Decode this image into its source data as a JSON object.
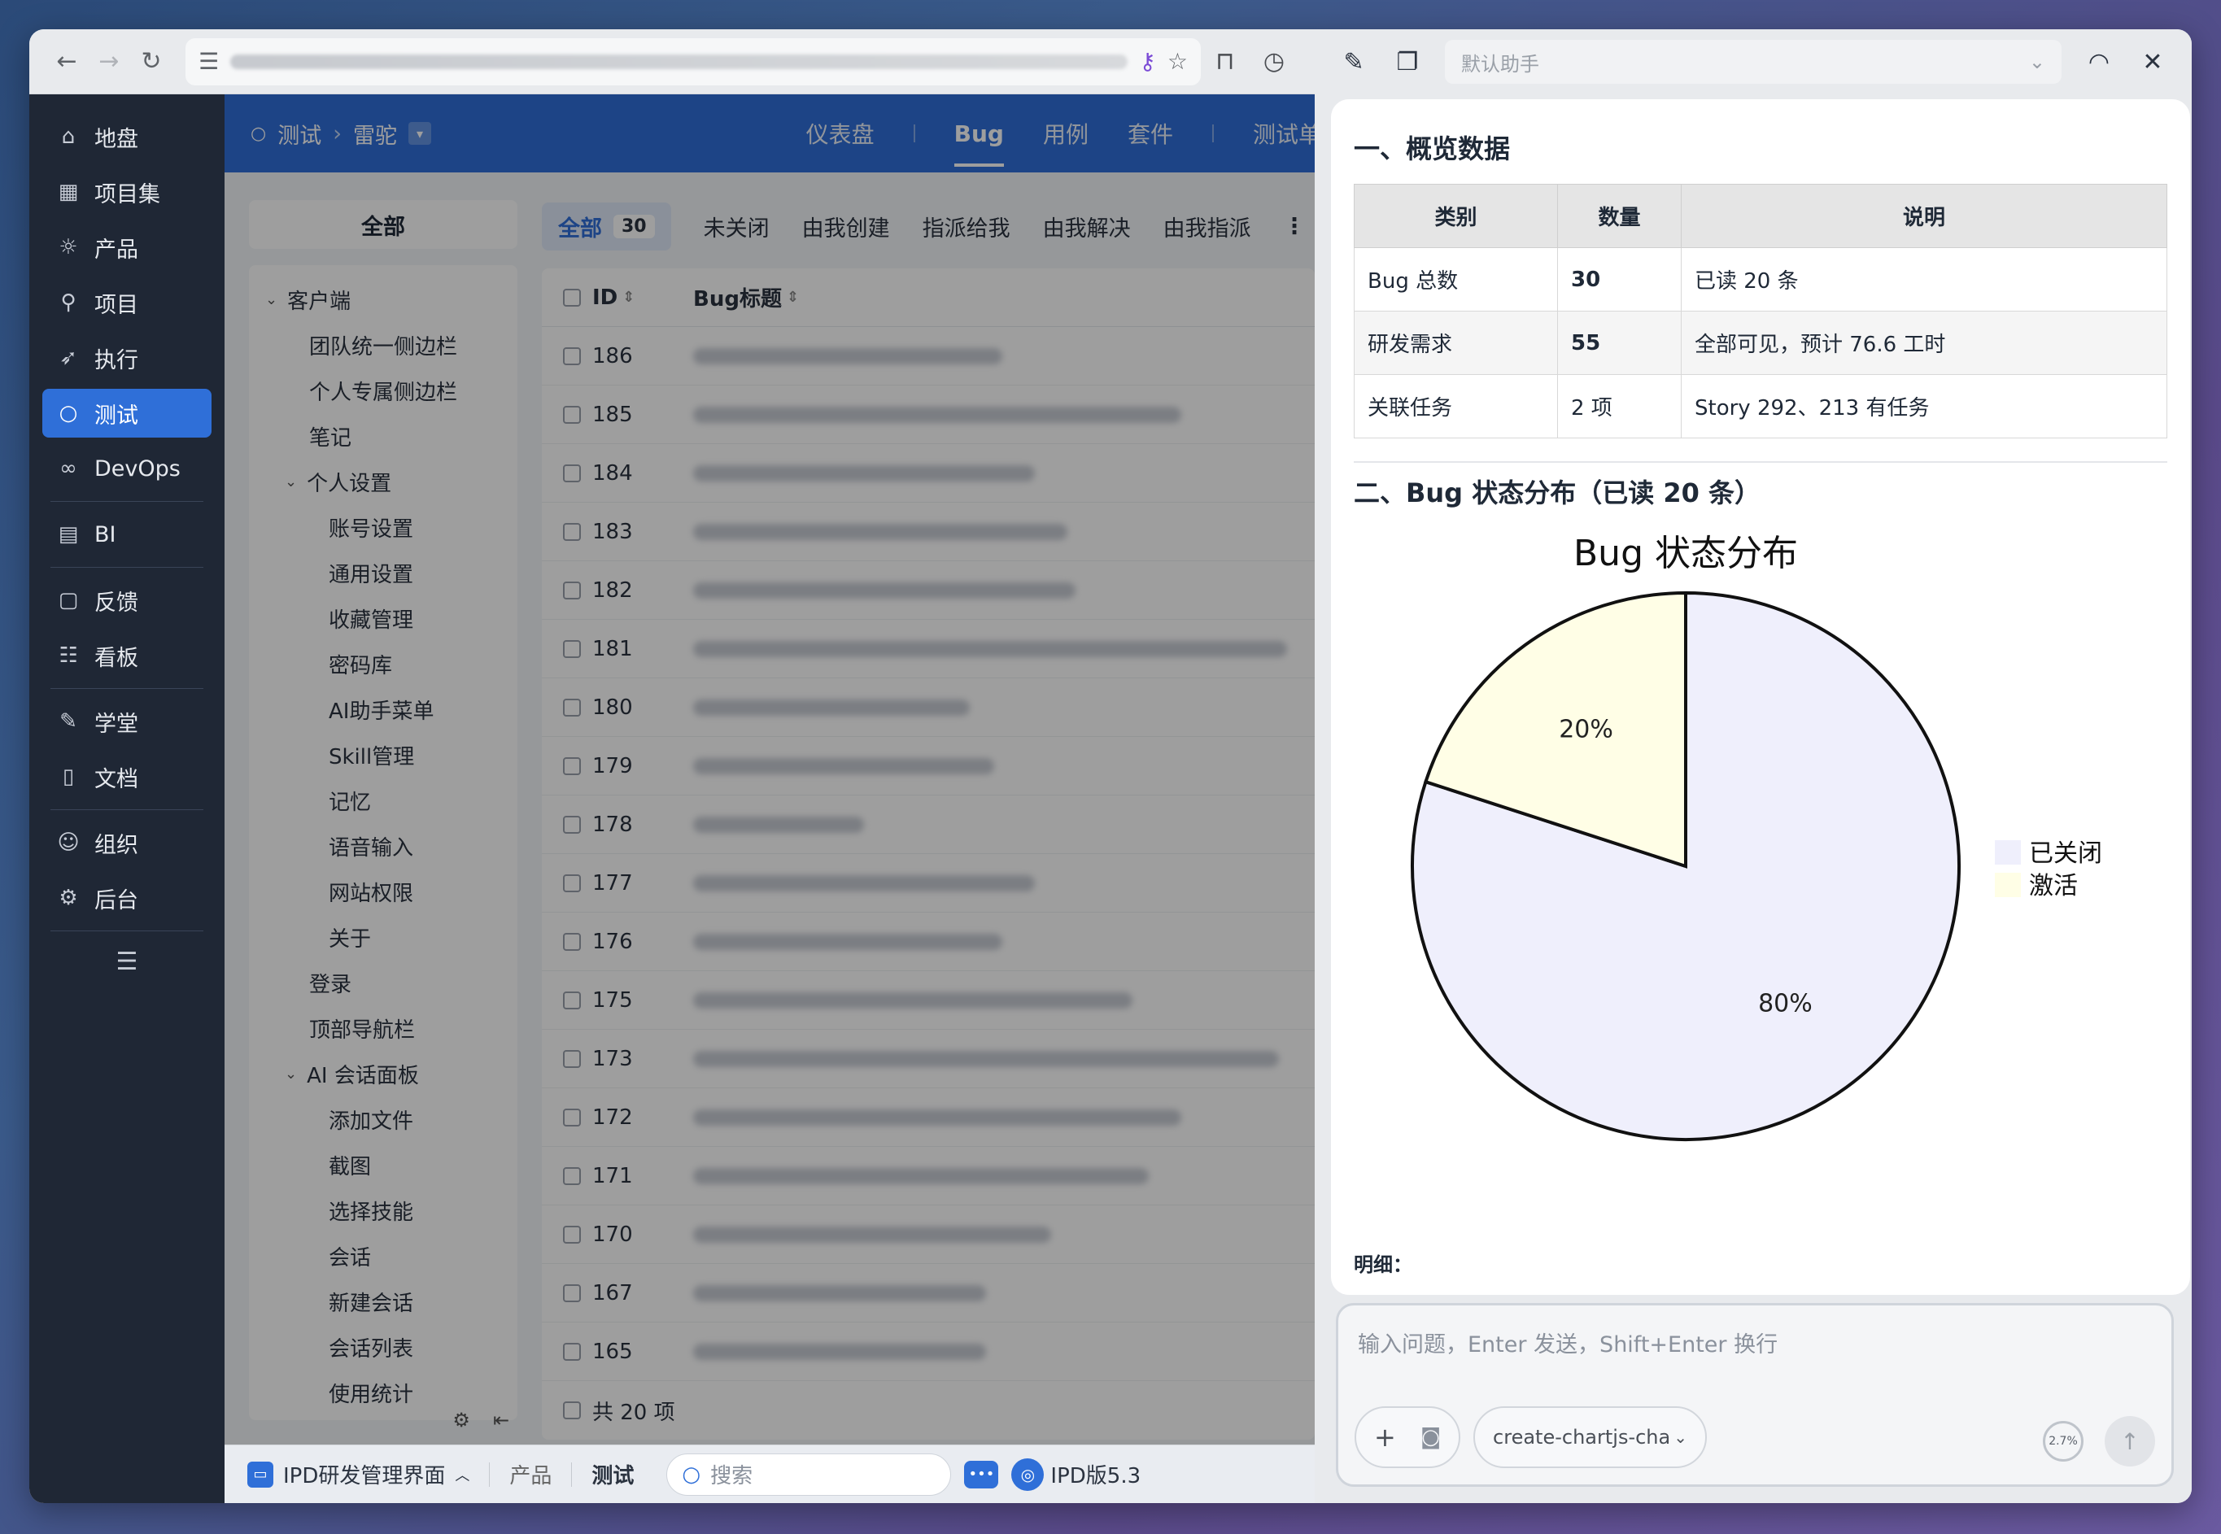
{
  "browser": {
    "icons": [
      "back-icon",
      "forward-icon",
      "reload-icon",
      "site-settings-icon",
      "password-key-icon",
      "star-icon",
      "bookmark-icon",
      "history-icon"
    ]
  },
  "leftnav": {
    "items": [
      {
        "label": "地盘",
        "icon": "home-icon"
      },
      {
        "label": "项目集",
        "icon": "grid-icon"
      },
      {
        "label": "产品",
        "icon": "bulb-icon"
      },
      {
        "label": "项目",
        "icon": "rocket-icon"
      },
      {
        "label": "执行",
        "icon": "run-icon"
      },
      {
        "label": "测试",
        "icon": "search-icon",
        "active": true
      },
      {
        "label": "DevOps",
        "icon": "infinity-icon"
      },
      {
        "label": "BI",
        "icon": "chart-icon"
      },
      {
        "label": "反馈",
        "icon": "feedback-icon"
      },
      {
        "label": "看板",
        "icon": "board-icon"
      },
      {
        "label": "学堂",
        "icon": "school-icon"
      },
      {
        "label": "文档",
        "icon": "doc-icon"
      },
      {
        "label": "组织",
        "icon": "people-icon"
      },
      {
        "label": "后台",
        "icon": "gear-icon"
      }
    ]
  },
  "topbar": {
    "crumb_root": "测试",
    "crumb_current": "雷驼",
    "tabs": [
      "仪表盘",
      "Bug",
      "用例",
      "套件",
      "测试单"
    ],
    "active_tab": "Bug"
  },
  "tree": {
    "all_label": "全部",
    "nodes": [
      {
        "label": "客户端",
        "level": 0,
        "caret": true
      },
      {
        "label": "团队统一侧边栏",
        "level": 1
      },
      {
        "label": "个人专属侧边栏",
        "level": 1
      },
      {
        "label": "笔记",
        "level": 1
      },
      {
        "label": "个人设置",
        "level": 1,
        "caret": true
      },
      {
        "label": "账号设置",
        "level": 2
      },
      {
        "label": "通用设置",
        "level": 2
      },
      {
        "label": "收藏管理",
        "level": 2
      },
      {
        "label": "密码库",
        "level": 2
      },
      {
        "label": "AI助手菜单",
        "level": 2
      },
      {
        "label": "Skill管理",
        "level": 2
      },
      {
        "label": "记忆",
        "level": 2
      },
      {
        "label": "语音输入",
        "level": 2
      },
      {
        "label": "网站权限",
        "level": 2
      },
      {
        "label": "关于",
        "level": 2
      },
      {
        "label": "登录",
        "level": 1
      },
      {
        "label": "顶部导航栏",
        "level": 1
      },
      {
        "label": "AI 会话面板",
        "level": 1,
        "caret": true
      },
      {
        "label": "添加文件",
        "level": 2
      },
      {
        "label": "截图",
        "level": 2
      },
      {
        "label": "选择技能",
        "level": 2
      },
      {
        "label": "会话",
        "level": 2
      },
      {
        "label": "新建会话",
        "level": 2
      },
      {
        "label": "会话列表",
        "level": 2
      },
      {
        "label": "使用统计",
        "level": 2
      }
    ]
  },
  "filters": {
    "all_label": "全部",
    "all_count": "30",
    "items": [
      "未关闭",
      "由我创建",
      "指派给我",
      "由我解决",
      "由我指派"
    ]
  },
  "table": {
    "col_id": "ID",
    "col_title": "Bug标题",
    "ids": [
      "186",
      "185",
      "184",
      "183",
      "182",
      "181",
      "180",
      "179",
      "178",
      "177",
      "176",
      "175",
      "173",
      "172",
      "171",
      "170",
      "167",
      "165"
    ],
    "footer": "共 20 项"
  },
  "statusbar": {
    "app": "IPD研发管理界面",
    "crumb1": "产品",
    "crumb2": "测试",
    "search_placeholder": "搜索",
    "version": "IPD版5.3"
  },
  "assistant": {
    "select_placeholder": "默认助手",
    "section1": "一、概览数据",
    "table_headers": [
      "类别",
      "数量",
      "说明"
    ],
    "table_rows": [
      [
        "Bug 总数",
        "30",
        "已读 20 条"
      ],
      [
        "研发需求",
        "55",
        "全部可见，预计 76.6 工时"
      ],
      [
        "关联任务",
        "2 项",
        "Story 292、213 有任务"
      ]
    ],
    "section2": "二、Bug 状态分布（已读 20 条）",
    "mingxi": "明细：",
    "input_placeholder": "输入问题，Enter 发送，Shift+Enter 换行",
    "skill_pill": "create-chartjs-cha",
    "usage": "2.7%"
  },
  "chart_data": {
    "type": "pie",
    "title": "Bug 状态分布",
    "labels": [
      "已关闭",
      "激活"
    ],
    "values": [
      80,
      20
    ],
    "value_labels": [
      "80%",
      "20%"
    ],
    "colors": [
      "#efeffc",
      "#fffee6"
    ],
    "legend": "right"
  }
}
